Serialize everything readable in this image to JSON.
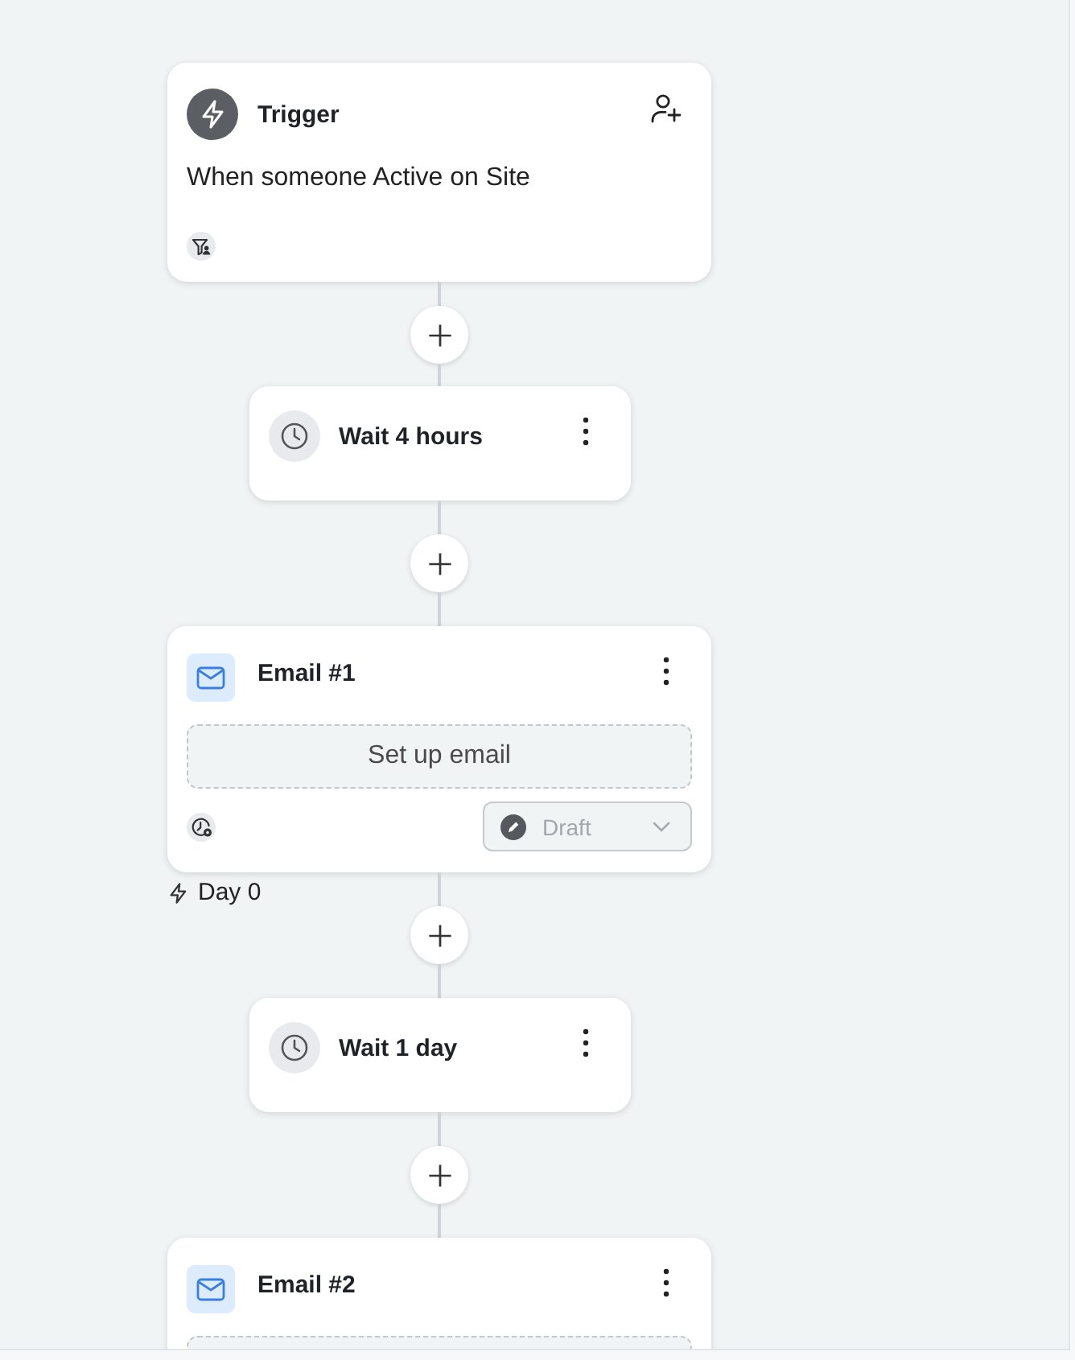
{
  "steps": [
    {
      "kind": "trigger",
      "title": "Trigger",
      "description": "When someone Active on Site"
    },
    {
      "kind": "wait",
      "title": "Wait 4 hours"
    },
    {
      "kind": "email",
      "title": "Email #1",
      "setup_button": "Set up email",
      "status": {
        "label": "Draft",
        "disabled": true
      },
      "day_label": "Day 0"
    },
    {
      "kind": "wait",
      "title": "Wait 1 day"
    },
    {
      "kind": "email",
      "title": "Email #2"
    }
  ]
}
